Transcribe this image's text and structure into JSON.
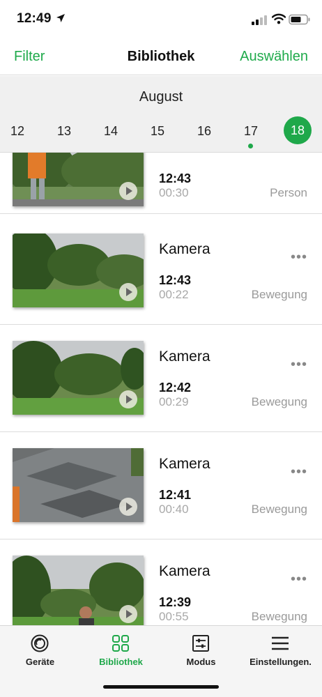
{
  "status_bar": {
    "time": "12:49"
  },
  "nav": {
    "left": "Filter",
    "title": "Bibliothek",
    "right": "Auswählen"
  },
  "date_strip": {
    "month": "August",
    "days": [
      "12",
      "13",
      "14",
      "15",
      "16",
      "17",
      "18"
    ],
    "selected_day": "18",
    "marked_day": "17"
  },
  "events": [
    {
      "camera": "",
      "time": "12:43",
      "duration": "00:30",
      "type": "Person"
    },
    {
      "camera": "Kamera",
      "time": "12:43",
      "duration": "00:22",
      "type": "Bewegung",
      "more": "•••"
    },
    {
      "camera": "Kamera",
      "time": "12:42",
      "duration": "00:29",
      "type": "Bewegung",
      "more": "•••"
    },
    {
      "camera": "Kamera",
      "time": "12:41",
      "duration": "00:40",
      "type": "Bewegung",
      "more": "•••"
    },
    {
      "camera": "Kamera",
      "time": "12:39",
      "duration": "00:55",
      "type": "Bewegung",
      "more": "•••"
    }
  ],
  "tabs": [
    {
      "label": "Geräte",
      "icon": "devices-icon",
      "active": false
    },
    {
      "label": "Bibliothek",
      "icon": "library-grid-icon",
      "active": true
    },
    {
      "label": "Modus",
      "icon": "mode-sliders-icon",
      "active": false
    },
    {
      "label": "Einstellungen.",
      "icon": "menu-icon",
      "active": false
    }
  ],
  "colors": {
    "accent": "#1fa84a",
    "muted_text": "#a8a8a8",
    "strip_bg": "#f0f0f0"
  }
}
